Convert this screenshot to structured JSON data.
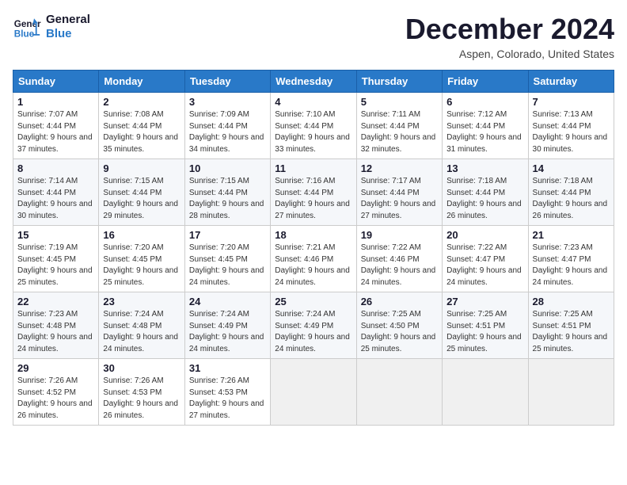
{
  "logo": {
    "line1": "General",
    "line2": "Blue"
  },
  "title": "December 2024",
  "location": "Aspen, Colorado, United States",
  "days_of_week": [
    "Sunday",
    "Monday",
    "Tuesday",
    "Wednesday",
    "Thursday",
    "Friday",
    "Saturday"
  ],
  "weeks": [
    [
      {
        "day": "1",
        "sunrise": "7:07 AM",
        "sunset": "4:44 PM",
        "daylight": "9 hours and 37 minutes."
      },
      {
        "day": "2",
        "sunrise": "7:08 AM",
        "sunset": "4:44 PM",
        "daylight": "9 hours and 35 minutes."
      },
      {
        "day": "3",
        "sunrise": "7:09 AM",
        "sunset": "4:44 PM",
        "daylight": "9 hours and 34 minutes."
      },
      {
        "day": "4",
        "sunrise": "7:10 AM",
        "sunset": "4:44 PM",
        "daylight": "9 hours and 33 minutes."
      },
      {
        "day": "5",
        "sunrise": "7:11 AM",
        "sunset": "4:44 PM",
        "daylight": "9 hours and 32 minutes."
      },
      {
        "day": "6",
        "sunrise": "7:12 AM",
        "sunset": "4:44 PM",
        "daylight": "9 hours and 31 minutes."
      },
      {
        "day": "7",
        "sunrise": "7:13 AM",
        "sunset": "4:44 PM",
        "daylight": "9 hours and 30 minutes."
      }
    ],
    [
      {
        "day": "8",
        "sunrise": "7:14 AM",
        "sunset": "4:44 PM",
        "daylight": "9 hours and 30 minutes."
      },
      {
        "day": "9",
        "sunrise": "7:15 AM",
        "sunset": "4:44 PM",
        "daylight": "9 hours and 29 minutes."
      },
      {
        "day": "10",
        "sunrise": "7:15 AM",
        "sunset": "4:44 PM",
        "daylight": "9 hours and 28 minutes."
      },
      {
        "day": "11",
        "sunrise": "7:16 AM",
        "sunset": "4:44 PM",
        "daylight": "9 hours and 27 minutes."
      },
      {
        "day": "12",
        "sunrise": "7:17 AM",
        "sunset": "4:44 PM",
        "daylight": "9 hours and 27 minutes."
      },
      {
        "day": "13",
        "sunrise": "7:18 AM",
        "sunset": "4:44 PM",
        "daylight": "9 hours and 26 minutes."
      },
      {
        "day": "14",
        "sunrise": "7:18 AM",
        "sunset": "4:44 PM",
        "daylight": "9 hours and 26 minutes."
      }
    ],
    [
      {
        "day": "15",
        "sunrise": "7:19 AM",
        "sunset": "4:45 PM",
        "daylight": "9 hours and 25 minutes."
      },
      {
        "day": "16",
        "sunrise": "7:20 AM",
        "sunset": "4:45 PM",
        "daylight": "9 hours and 25 minutes."
      },
      {
        "day": "17",
        "sunrise": "7:20 AM",
        "sunset": "4:45 PM",
        "daylight": "9 hours and 24 minutes."
      },
      {
        "day": "18",
        "sunrise": "7:21 AM",
        "sunset": "4:46 PM",
        "daylight": "9 hours and 24 minutes."
      },
      {
        "day": "19",
        "sunrise": "7:22 AM",
        "sunset": "4:46 PM",
        "daylight": "9 hours and 24 minutes."
      },
      {
        "day": "20",
        "sunrise": "7:22 AM",
        "sunset": "4:47 PM",
        "daylight": "9 hours and 24 minutes."
      },
      {
        "day": "21",
        "sunrise": "7:23 AM",
        "sunset": "4:47 PM",
        "daylight": "9 hours and 24 minutes."
      }
    ],
    [
      {
        "day": "22",
        "sunrise": "7:23 AM",
        "sunset": "4:48 PM",
        "daylight": "9 hours and 24 minutes."
      },
      {
        "day": "23",
        "sunrise": "7:24 AM",
        "sunset": "4:48 PM",
        "daylight": "9 hours and 24 minutes."
      },
      {
        "day": "24",
        "sunrise": "7:24 AM",
        "sunset": "4:49 PM",
        "daylight": "9 hours and 24 minutes."
      },
      {
        "day": "25",
        "sunrise": "7:24 AM",
        "sunset": "4:49 PM",
        "daylight": "9 hours and 24 minutes."
      },
      {
        "day": "26",
        "sunrise": "7:25 AM",
        "sunset": "4:50 PM",
        "daylight": "9 hours and 25 minutes."
      },
      {
        "day": "27",
        "sunrise": "7:25 AM",
        "sunset": "4:51 PM",
        "daylight": "9 hours and 25 minutes."
      },
      {
        "day": "28",
        "sunrise": "7:25 AM",
        "sunset": "4:51 PM",
        "daylight": "9 hours and 25 minutes."
      }
    ],
    [
      {
        "day": "29",
        "sunrise": "7:26 AM",
        "sunset": "4:52 PM",
        "daylight": "9 hours and 26 minutes."
      },
      {
        "day": "30",
        "sunrise": "7:26 AM",
        "sunset": "4:53 PM",
        "daylight": "9 hours and 26 minutes."
      },
      {
        "day": "31",
        "sunrise": "7:26 AM",
        "sunset": "4:53 PM",
        "daylight": "9 hours and 27 minutes."
      },
      null,
      null,
      null,
      null
    ]
  ],
  "labels": {
    "sunrise": "Sunrise:",
    "sunset": "Sunset:",
    "daylight": "Daylight:"
  }
}
